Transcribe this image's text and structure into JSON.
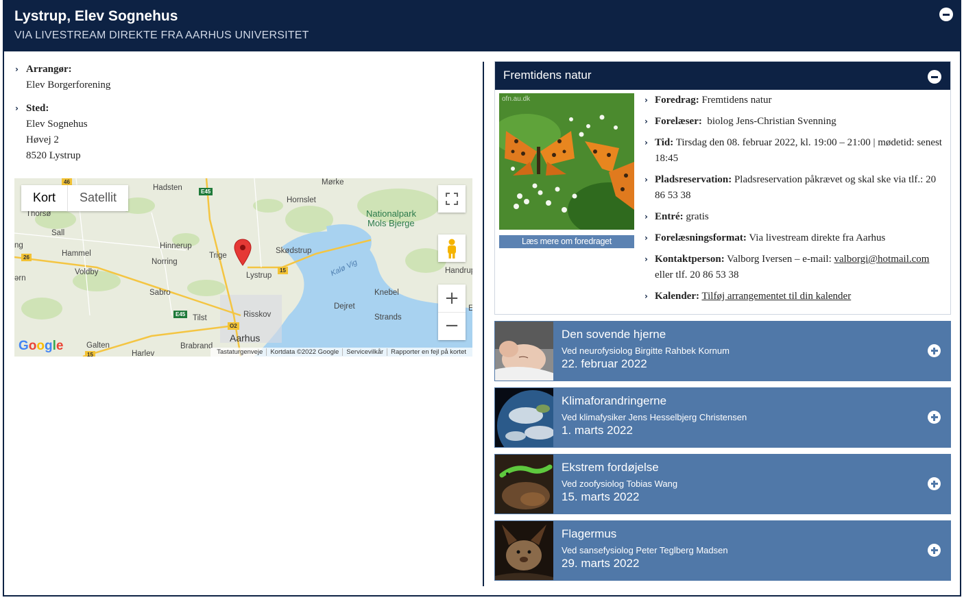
{
  "header": {
    "title": "Lystrup, Elev Sognehus",
    "subtitle": "VIA LIVESTREAM DIREKTE FRA AARHUS UNIVERSITET"
  },
  "info": {
    "organizer_label": "Arrangør",
    "organizer_value": "Elev Borgerforening",
    "place_label": "Sted",
    "place_lines": [
      "Elev Sognehus",
      "Høvej 2",
      "8520 Lystrup"
    ]
  },
  "map": {
    "type_kort": "Kort",
    "type_satellit": "Satellit",
    "labels": {
      "hadsten": "Hadsten",
      "morke": "Mørke",
      "hornslet": "Hornslet",
      "thorso": "Thorsø",
      "sall": "Sall",
      "ng": "ng",
      "hammel": "Hammel",
      "hinnerup": "Hinnerup",
      "trige": "Trige",
      "skodstrup": "Skødstrup",
      "norring": "Norring",
      "voldby": "Voldby",
      "lystrup": "Lystrup",
      "rn": "ərn",
      "handrup": "Handrup",
      "sabro": "Sabro",
      "knebel": "Knebel",
      "djeret": "Dejret",
      "risskov": "Risskov",
      "tilst": "Tilst",
      "strands": "Strands",
      "aarhus": "Aarhus",
      "galten": "Galten",
      "brabrand": "Brabrand",
      "harlev": "Harlev",
      "nationalpark": "Nationalpark",
      "mols": "Mols Bjerge",
      "kalo": "Kalø Vig",
      "e_end": "E"
    },
    "roads": {
      "r46": "46",
      "e45a": "E45",
      "r26": "26",
      "r15a": "15",
      "e45b": "E45",
      "r02": "O2",
      "r15b": "15"
    },
    "google": "Google",
    "attribution": [
      "Tastaturgenveje",
      "Kortdata ©2022 Google",
      "Servicevilkår",
      "Rapporter en fejl på kortet"
    ]
  },
  "feature": {
    "title": "Fremtidens natur",
    "image_watermark": "ofn.au.dk",
    "read_more": "Læs mere om foredraget",
    "rows": {
      "foredrag_label": "Foredrag",
      "foredrag_value": "Fremtidens natur",
      "foreleser_label": "Forelæser",
      "foreleser_value": "biolog Jens-Christian Svenning",
      "tid_label": "Tid",
      "tid_value": "Tirsdag den 08. februar 2022, kl. 19:00 – 21:00 | mødetid: senest 18:45",
      "plads_label": "Pladsreservation",
      "plads_value": "Pladsreservation påkrævet og skal ske via tlf.: 20 86 53 38",
      "entre_label": "Entré",
      "entre_value": "gratis",
      "format_label": "Forelæsningsformat",
      "format_value": "Via livestream direkte fra Aarhus",
      "kontakt_label": "Kontaktperson",
      "kontakt_value": "Valborg Iversen – e-mail:",
      "kontakt_email": "valborgi@hotmail.com",
      "kontakt_rest": "eller tlf. 20 86 53 38",
      "kalender_label": "Kalender",
      "kalender_link": "Tilføj arrangementet til din kalender"
    }
  },
  "lectures": [
    {
      "title": "Den sovende hjerne",
      "subtitle": "Ved neurofysiolog Birgitte Rahbek Kornum",
      "date": "22. februar 2022"
    },
    {
      "title": "Klimaforandringerne",
      "subtitle": "Ved klimafysiker Jens Hesselbjerg Christensen",
      "date": "1. marts 2022"
    },
    {
      "title": "Ekstrem fordøjelse",
      "subtitle": "Ved zoofysiolog Tobias Wang",
      "date": "15. marts 2022"
    },
    {
      "title": "Flagermus",
      "subtitle": "Ved sansefysiolog Peter Teglberg Madsen",
      "date": "29. marts 2022"
    }
  ],
  "colors": {
    "navy": "#0d2244",
    "lecture_blue": "#5078a8",
    "button_blue": "#5b82b2"
  }
}
